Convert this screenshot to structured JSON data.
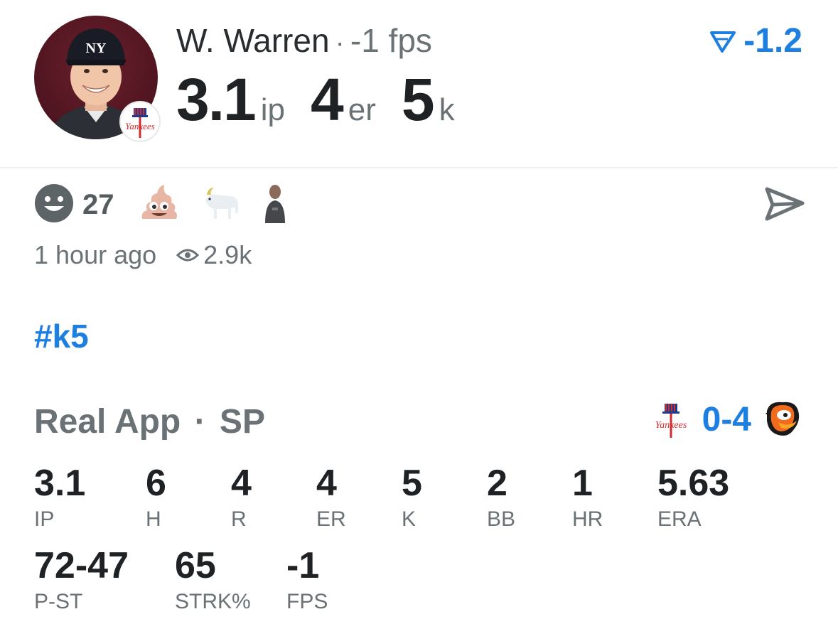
{
  "player": {
    "name": "W. Warren",
    "separator": "·",
    "fps": "-1 fps",
    "line": [
      {
        "value": "3.1",
        "unit": "ip"
      },
      {
        "value": "4",
        "unit": "er"
      },
      {
        "value": "5",
        "unit": "k"
      }
    ],
    "score": "-1.2",
    "avatar_icon": "player-avatar",
    "team_icon": "yankees-logo"
  },
  "reactions": {
    "face_icon": "smiley-face-icon",
    "count": "27",
    "emojis": [
      "poop-emoji",
      "goat-emoji",
      "person-emoji"
    ],
    "share_icon": "send-icon"
  },
  "meta": {
    "time": "1 hour ago",
    "views": "2.9k",
    "views_icon": "eye-icon"
  },
  "hashtag": "#k5",
  "boxscore": {
    "source": "Real App",
    "separator": "·",
    "position": "SP",
    "game": {
      "score": "0-4",
      "home_logo": "yankees-logo",
      "away_logo": "orioles-logo"
    },
    "row1": [
      {
        "value": "3.1",
        "label": "IP"
      },
      {
        "value": "6",
        "label": "H"
      },
      {
        "value": "4",
        "label": "R"
      },
      {
        "value": "4",
        "label": "ER"
      },
      {
        "value": "5",
        "label": "K"
      },
      {
        "value": "2",
        "label": "BB"
      },
      {
        "value": "1",
        "label": "HR"
      },
      {
        "value": "5.63",
        "label": "ERA"
      }
    ],
    "row2": [
      {
        "value": "72-47",
        "label": "P-ST"
      },
      {
        "value": "65",
        "label": "STRK%"
      },
      {
        "value": "-1",
        "label": "FPS"
      }
    ]
  },
  "colors": {
    "accent": "#1d7fe0",
    "muted": "#6b7276",
    "text": "#1f2225",
    "orioles": "#f26a1b"
  }
}
